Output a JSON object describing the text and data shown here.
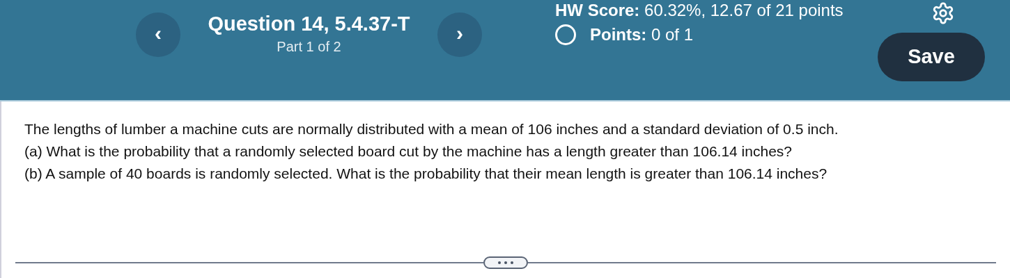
{
  "header": {
    "question_title": "Question 14, 5.4.37-T",
    "part": "Part 1 of 2",
    "hw_score": "**HW Score:** 60.32%, 12.67 of 21 points",
    "points": "**Points:** 0 of 1",
    "points_complete": false,
    "save_label": "Save",
    "prev_label": "‹",
    "next_label": "›"
  },
  "question": {
    "paragraphs": [
      "The lengths of lumber a machine cuts are normally distributed with a mean of 106 inches and a standard deviation of 0.5 inch.",
      "(a) What is the probability that a randomly selected board cut by the machine has a length greater than 106.14 inches?",
      "(b) A sample of 40 boards is randomly selected. What is the probability that their mean length is greater than 106.14 inches?"
    ]
  }
}
